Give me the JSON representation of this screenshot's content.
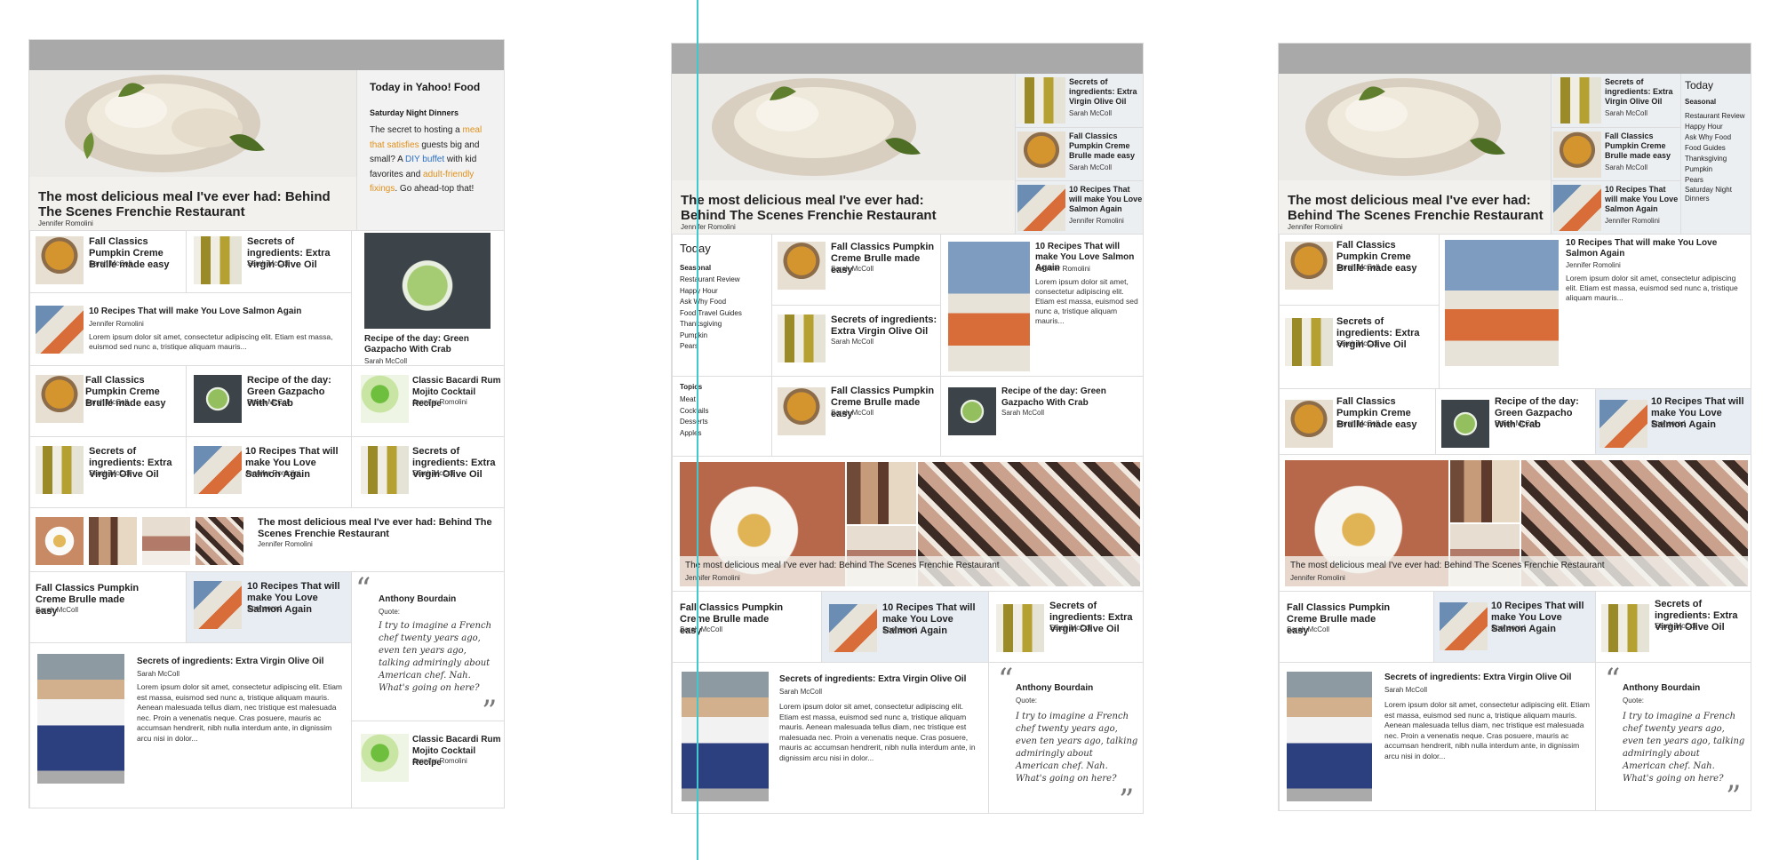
{
  "items": {
    "main": {
      "title": "The most delicious meal I've ever had: Behind The Scenes Frenchie Restaurant",
      "author": "Jennifer Romolini"
    },
    "pumpkin": {
      "title": "Fall Classics Pumpkin Creme Brulle made easy",
      "author": "Sarah McColl"
    },
    "oil": {
      "title": "Secrets of ingredients: Extra Virgin Olive Oil",
      "author": "Sarah McColl"
    },
    "salmon": {
      "title": "10 Recipes That will make You Love Salmon Again",
      "author": "Jennifer Romolini",
      "sponsor": "Sponsored"
    },
    "salmon_long": {
      "title": "10 Recipes That will make You Love Salmon Again",
      "author": "Jennifer Romolini"
    },
    "gazpacho": {
      "title": "Recipe of the day: Green Gazpacho With Crab",
      "author": "Sarah McColl"
    },
    "mojito": {
      "title": "Classic Bacardi Rum Mojito Cocktail Recipe",
      "author": "Jennifer Romolini"
    },
    "lorem_short": "Lorem ipsum dolor sit amet, consectetur adipiscing elit. Etiam est massa, euismod sed nunc a, tristique aliquam mauris...",
    "lorem_long": "Lorem ipsum dolor sit amet, consectetur adipiscing elit. Etiam est massa, euismod sed nunc a, tristique aliquam mauris. Aenean malesuada tellus diam, nec tristique est malesuada nec. Proin a venenatis neque. Cras posuere, mauris ac accumsan hendrerit, nibh nulla interdum ante, in dignissim arcu nisi in dolor...",
    "quote": {
      "name": "Anthony Bourdain",
      "label": "Quote:",
      "text": "I try to imagine a French chef twenty years ago, even ten years ago, talking admiringly about American chef. Nah. What's going on here?",
      "open": "“",
      "close": "”"
    }
  },
  "today_panel": {
    "heading": "Today in Yahoo! Food",
    "subheading": "Saturday Night Dinners",
    "text_1": "The secret to hosting a ",
    "link_1": "meal that satisfies",
    "text_2": " guests big and small? A ",
    "link_2": "DIY buffet",
    "text_3": " with kid favorites and ",
    "link_3": "adult-friendly fixings",
    "text_4": ". Go ahead-top that!"
  },
  "sidebar": {
    "today_label": "Today",
    "seasonal_label": "Seasonal",
    "seasonal_items": [
      "Restaurant Review",
      "Happy Hour",
      "Ask Why Food",
      "Food Travel Guides",
      "Thanksgiving",
      "Pumpkin",
      "Pears"
    ],
    "seasonal_items_3": [
      "Restaurant Review",
      "Happy Hour",
      "Ask Why Food",
      "Food Guides",
      "Thanksgiving",
      "Pumpkin",
      "Pears",
      "Saturday Night Dinners"
    ],
    "topics_label": "Topics",
    "topics_items": [
      "Meat",
      "Cocktails",
      "Desserts",
      "Apples"
    ]
  },
  "colors": {
    "accent_orange": "#e0901a",
    "accent_blue": "#2b6fc4",
    "header_gray": "#a9a9a9",
    "sponsored_bg": "#e8edf3",
    "guide_cyan": "#3fc9cf"
  }
}
